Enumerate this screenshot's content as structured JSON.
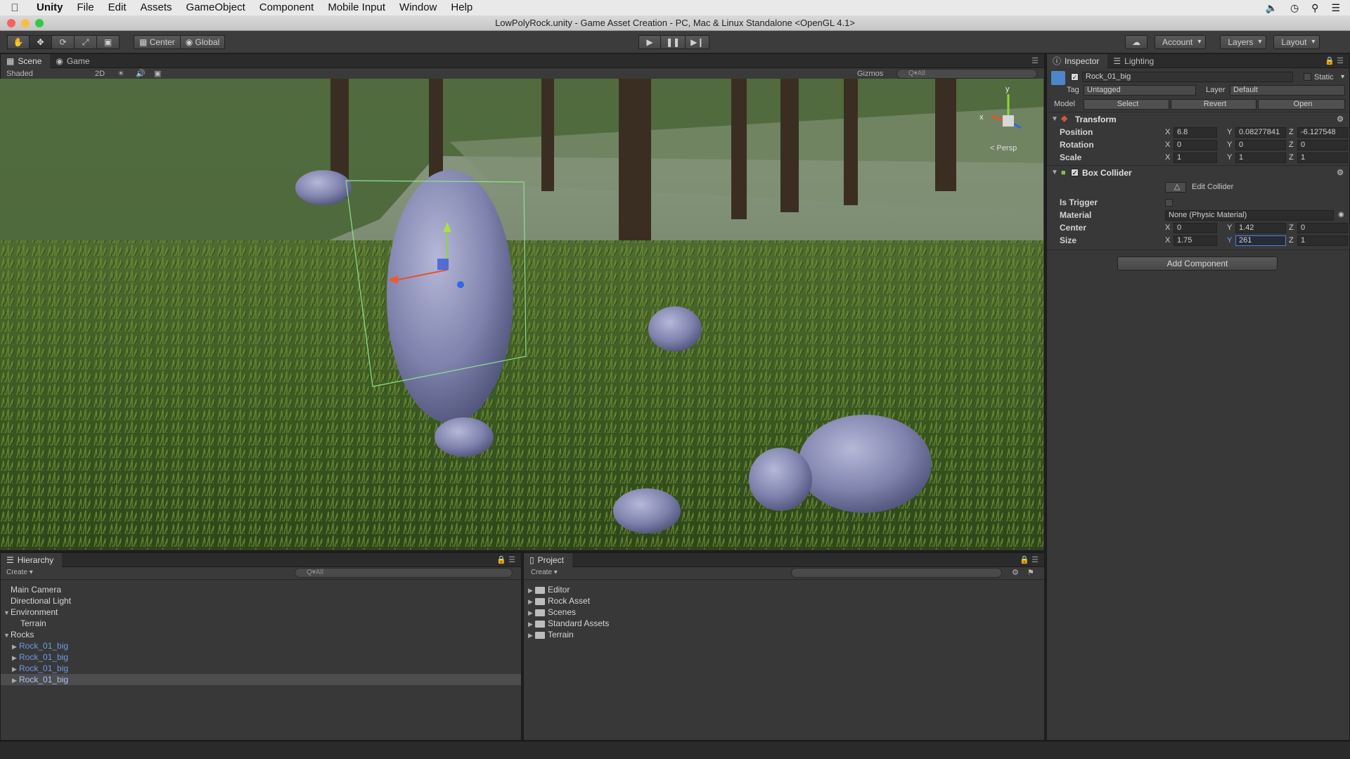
{
  "menubar": {
    "app": "Unity",
    "items": [
      "File",
      "Edit",
      "Assets",
      "GameObject",
      "Component",
      "Mobile Input",
      "Window",
      "Help"
    ]
  },
  "window": {
    "title": "LowPolyRock.unity - Game Asset Creation - PC, Mac & Linux Standalone <OpenGL 4.1>"
  },
  "toolbar": {
    "pivot": "Center",
    "space": "Global",
    "account": "Account",
    "layers": "Layers",
    "layout": "Layout"
  },
  "scene": {
    "tabs": [
      "Scene",
      "Game"
    ],
    "shading": "Shaded",
    "mode_2d": "2D",
    "gizmos": "Gizmos",
    "search_placeholder": "Q▾All",
    "persp": "< Persp",
    "axis_x": "x",
    "axis_y": "y"
  },
  "inspector": {
    "tabs": [
      "Inspector",
      "Lighting"
    ],
    "object_name": "Rock_01_big",
    "static_label": "Static",
    "tag_label": "Tag",
    "tag_value": "Untagged",
    "layer_label": "Layer",
    "layer_value": "Default",
    "model_label": "Model",
    "model_buttons": [
      "Select",
      "Revert",
      "Open"
    ],
    "transform": {
      "title": "Transform",
      "rows": [
        {
          "label": "Position",
          "x": "6.8",
          "y": "0.08277841",
          "z": "-6.127548"
        },
        {
          "label": "Rotation",
          "x": "0",
          "y": "0",
          "z": "0"
        },
        {
          "label": "Scale",
          "x": "1",
          "y": "1",
          "z": "1"
        }
      ]
    },
    "box_collider": {
      "title": "Box Collider",
      "edit_collider": "Edit Collider",
      "is_trigger_label": "Is Trigger",
      "material_label": "Material",
      "material_value": "None (Physic Material)",
      "center": {
        "label": "Center",
        "x": "0",
        "y": "1.42",
        "z": "0"
      },
      "size": {
        "label": "Size",
        "x": "1.75",
        "y": "261",
        "z": "1"
      }
    },
    "add_component": "Add Component",
    "axis_labels": {
      "x": "X",
      "y": "Y",
      "z": "Z"
    }
  },
  "hierarchy": {
    "tab": "Hierarchy",
    "create": "Create",
    "search_placeholder": "Q▾All",
    "items": [
      {
        "label": "Main Camera"
      },
      {
        "label": "Directional Light"
      },
      {
        "label": "Environment"
      },
      {
        "label": "Terrain"
      },
      {
        "label": "Rocks"
      },
      {
        "label": "Rock_01_big"
      },
      {
        "label": "Rock_01_big"
      },
      {
        "label": "Rock_01_big"
      },
      {
        "label": "Rock_01_big"
      }
    ]
  },
  "project": {
    "tab": "Project",
    "create": "Create",
    "items": [
      {
        "label": "Editor"
      },
      {
        "label": "Rock Asset"
      },
      {
        "label": "Scenes"
      },
      {
        "label": "Standard Assets"
      },
      {
        "label": "Terrain"
      }
    ]
  }
}
